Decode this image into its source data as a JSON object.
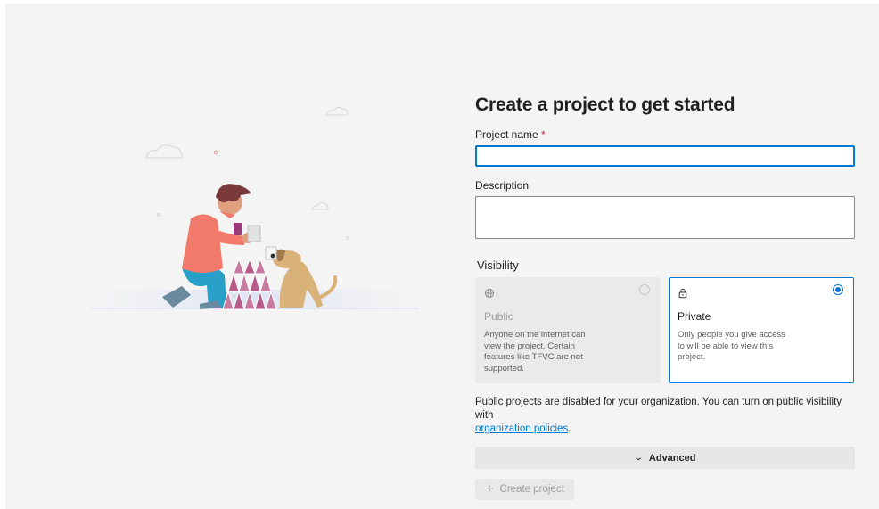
{
  "form": {
    "title": "Create a project to get started",
    "project_name_label": "Project name",
    "required_marker": "*",
    "project_name_value": "",
    "description_label": "Description",
    "description_value": "",
    "visibility_label": "Visibility"
  },
  "visibility_options": {
    "public": {
      "icon": "globe-icon",
      "title": "Public",
      "description": "Anyone on the internet can view the project. Certain features like TFVC are not supported.",
      "selected": false
    },
    "private": {
      "icon": "lock-icon",
      "title": "Private",
      "description": "Only people you give access to will be able to view this project.",
      "selected": true
    }
  },
  "notice": {
    "text": "Public projects are disabled for your organization. You can turn on public visibility with",
    "link_text": "organization policies",
    "suffix": "."
  },
  "advanced": {
    "label": "Advanced",
    "icon": "chevron-down-icon"
  },
  "create_button": {
    "label": "Create project",
    "icon": "plus-icon",
    "enabled": false
  },
  "colors": {
    "accent": "#0078d4",
    "background": "#f4f4f4",
    "required": "#d13438"
  }
}
